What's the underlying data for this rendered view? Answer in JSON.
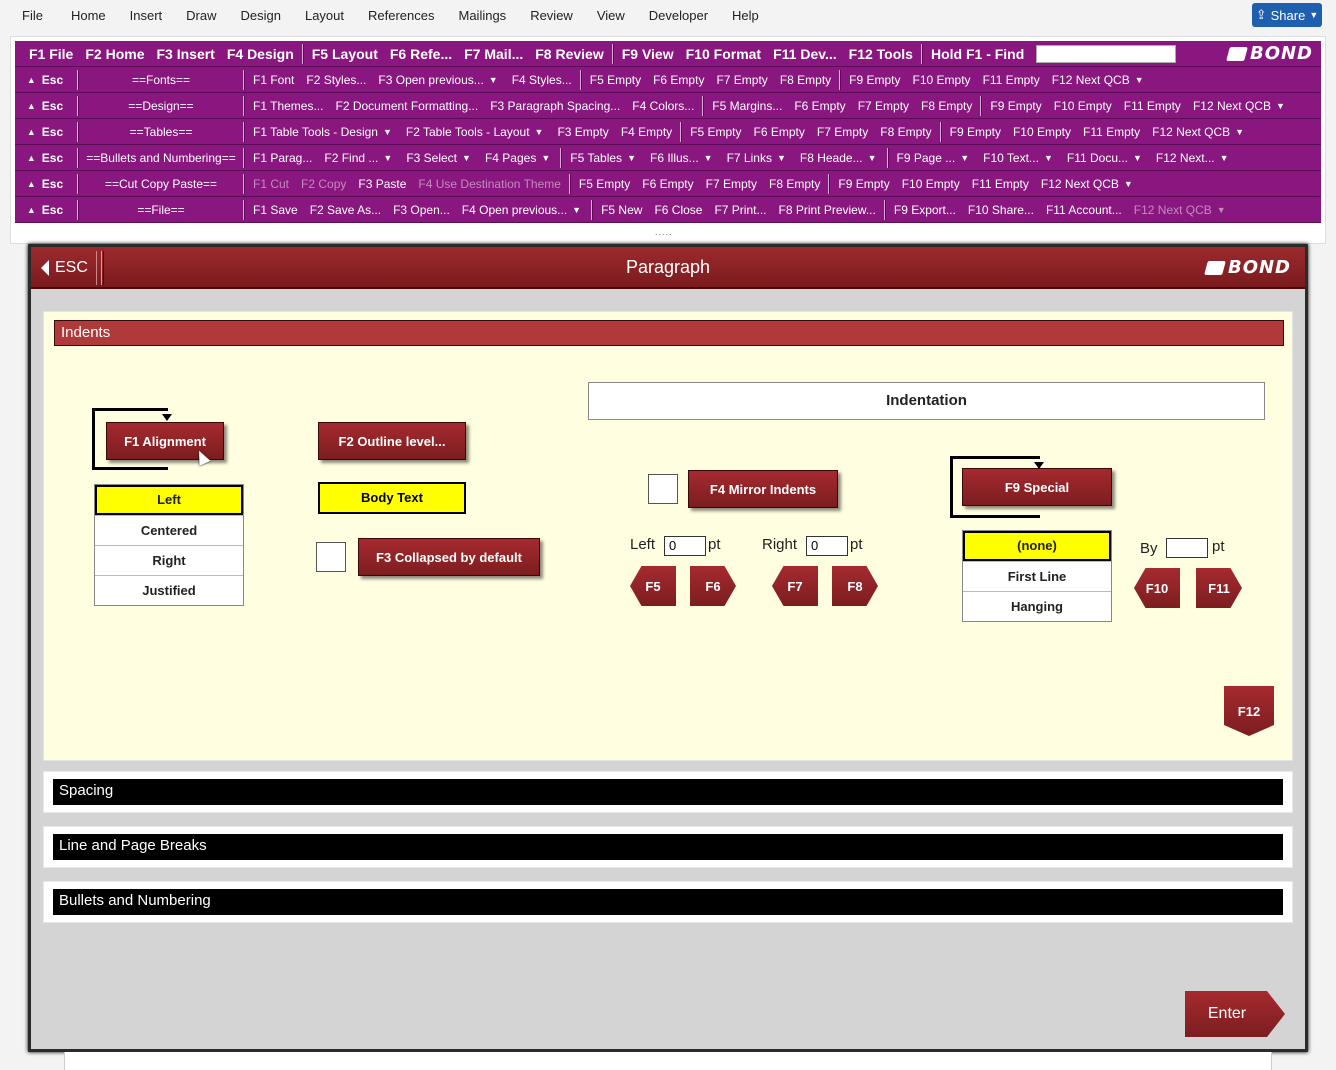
{
  "menubar": {
    "items": [
      "File",
      "Home",
      "Insert",
      "Draw",
      "Design",
      "Layout",
      "References",
      "Mailings",
      "Review",
      "View",
      "Developer",
      "Help"
    ],
    "share_label": "Share"
  },
  "qcb": {
    "top_row": [
      "F1 File",
      "F2 Home",
      "F3 Insert",
      "F4 Design",
      "F5 Layout",
      "F6 Refe...",
      "F7 Mail...",
      "F8 Review",
      "F9 View",
      "F10 Format",
      "F11 Dev...",
      "F12 Tools",
      "Hold F1 - Find"
    ],
    "logo_text": "BOND",
    "esc_label": "Esc",
    "rows": [
      {
        "group": "==Fonts==",
        "a": [
          "F1 Font",
          "F2 Styles...",
          "F3 Open previous...",
          "F4 Styles..."
        ],
        "b": [
          "F5 Empty",
          "F6 Empty",
          "F7 Empty",
          "F8 Empty"
        ],
        "c": [
          "F9 Empty",
          "F10 Empty",
          "F11 Empty",
          "F12 Next QCB"
        ]
      },
      {
        "group": "==Design==",
        "a": [
          "F1 Themes...",
          "F2 Document Formatting...",
          "F3 Paragraph Spacing...",
          "F4 Colors..."
        ],
        "b": [
          "F5 Margins...",
          "F6 Empty",
          "F7 Empty",
          "F8 Empty"
        ],
        "c": [
          "F9 Empty",
          "F10 Empty",
          "F11 Empty",
          "F12 Next QCB"
        ]
      },
      {
        "group": "==Tables==",
        "a": [
          "F1 Table Tools - Design",
          "F2 Table Tools - Layout",
          "F3 Empty",
          "F4 Empty"
        ],
        "b": [
          "F5 Empty",
          "F6 Empty",
          "F7 Empty",
          "F8 Empty"
        ],
        "c": [
          "F9 Empty",
          "F10 Empty",
          "F11 Empty",
          "F12 Next QCB"
        ]
      },
      {
        "group": "==Bullets and Numbering==",
        "a": [
          "F1 Parag...",
          "F2 Find ...",
          "F3 Select",
          "F4 Pages"
        ],
        "b": [
          "F5 Tables",
          "F6 Illus...",
          "F7 Links",
          "F8 Heade..."
        ],
        "c": [
          "F9 Page ...",
          "F10 Text...",
          "F11 Docu...",
          "F12 Next..."
        ]
      },
      {
        "group": "==Cut Copy Paste==",
        "a": [
          "F1 Cut",
          "F2 Copy",
          "F3 Paste",
          "F4 Use Destination Theme"
        ],
        "b": [
          "F5 Empty",
          "F6 Empty",
          "F7 Empty",
          "F8 Empty"
        ],
        "c": [
          "F9 Empty",
          "F10 Empty",
          "F11 Empty",
          "F12 Next QCB"
        ]
      },
      {
        "group": "==File==",
        "a": [
          "F1 Save",
          "F2 Save As...",
          "F3 Open...",
          "F4 Open previous..."
        ],
        "b": [
          "F5 New",
          "F6 Close",
          "F7 Print...",
          "F8 Print Preview..."
        ],
        "c": [
          "F9 Export...",
          "F10 Share...",
          "F11 Account...",
          "F12 Next QCB"
        ]
      }
    ]
  },
  "dialog": {
    "esc_label": "ESC",
    "title": "Paragraph",
    "logo_text": "BOND",
    "sections": {
      "indents": "Indents",
      "spacing": "Spacing",
      "line_page_breaks": "Line and Page Breaks",
      "bullets_numbering": "Bullets and Numbering"
    },
    "alignment": {
      "button": "F1 Alignment",
      "options": [
        "Left",
        "Centered",
        "Right",
        "Justified"
      ],
      "selected": "Left"
    },
    "outline": {
      "button": "F2 Outline level...",
      "value": "Body Text"
    },
    "collapsed": {
      "button": "F3 Collapsed by default",
      "checked": false
    },
    "indentation": {
      "title": "Indentation",
      "mirror_button": "F4 Mirror Indents",
      "mirror_checked": false,
      "left_label": "Left",
      "left_value": "0",
      "right_label": "Right",
      "right_value": "0",
      "unit": "pt",
      "f5": "F5",
      "f6": "F6",
      "f7": "F7",
      "f8": "F8"
    },
    "special": {
      "button": "F9 Special",
      "options": [
        "(none)",
        "First Line",
        "Hanging"
      ],
      "selected": "(none)",
      "by_label": "By",
      "by_value": "",
      "unit": "pt",
      "f10": "F10",
      "f11": "F11"
    },
    "f12": "F12",
    "enter": "Enter"
  },
  "colors": {
    "qcb_row": "#8a1680",
    "dialog_red": "#9c2a2e",
    "highlight": "#ffff00",
    "panel_bg": "#fffee0"
  }
}
